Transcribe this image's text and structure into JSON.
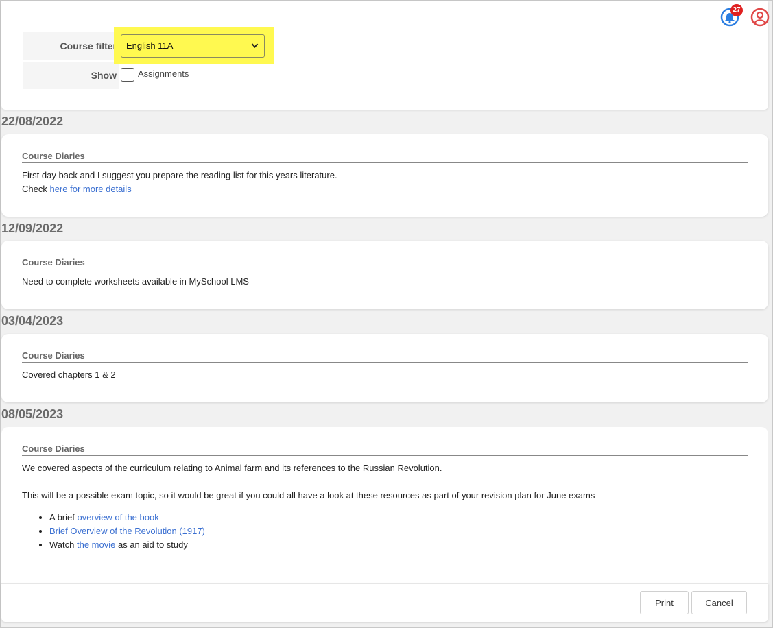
{
  "filter": {
    "course_label": "Course filter",
    "course_value": "English 11A",
    "show_label": "Show",
    "assignments_label": "Assignments"
  },
  "header": {
    "notification_count": "27",
    "bell_icon": "bell-icon",
    "user_icon": "user-circle-icon"
  },
  "entries": [
    {
      "date": "22/08/2022",
      "title": "Course Diaries",
      "line1": "First day back and I suggest you prepare the reading list for this years literature.",
      "line2_prefix": "Check ",
      "line2_link": "here for more details"
    },
    {
      "date": "12/09/2022",
      "title": "Course Diaries",
      "line1": "Need to complete worksheets available in MySchool LMS"
    },
    {
      "date": "03/04/2023",
      "title": "Course Diaries",
      "line1": "Covered chapters 1 & 2"
    },
    {
      "date": "08/05/2023",
      "title": "Course Diaries",
      "line1": "We covered aspects of the curriculum relating to Animal farm and its references to the Russian Revolution.",
      "line2": "This will be a possible exam topic, so it would be great if you could all have a look at these resources as part of your revision plan for June exams",
      "items": [
        {
          "prefix": "A brief ",
          "link": "overview of the book",
          "suffix": ""
        },
        {
          "prefix": "",
          "link": "Brief Overview of the Revolution (1917)",
          "suffix": ""
        },
        {
          "prefix": "Watch ",
          "link": "the movie",
          "suffix": " as an aid to study"
        }
      ]
    }
  ],
  "footer": {
    "print_label": "Print",
    "cancel_label": "Cancel"
  },
  "colors": {
    "highlight": "#fff950",
    "link": "#3a6fd1",
    "bell": "#2a7de1",
    "user": "#e04848",
    "badge": "#e02020"
  }
}
